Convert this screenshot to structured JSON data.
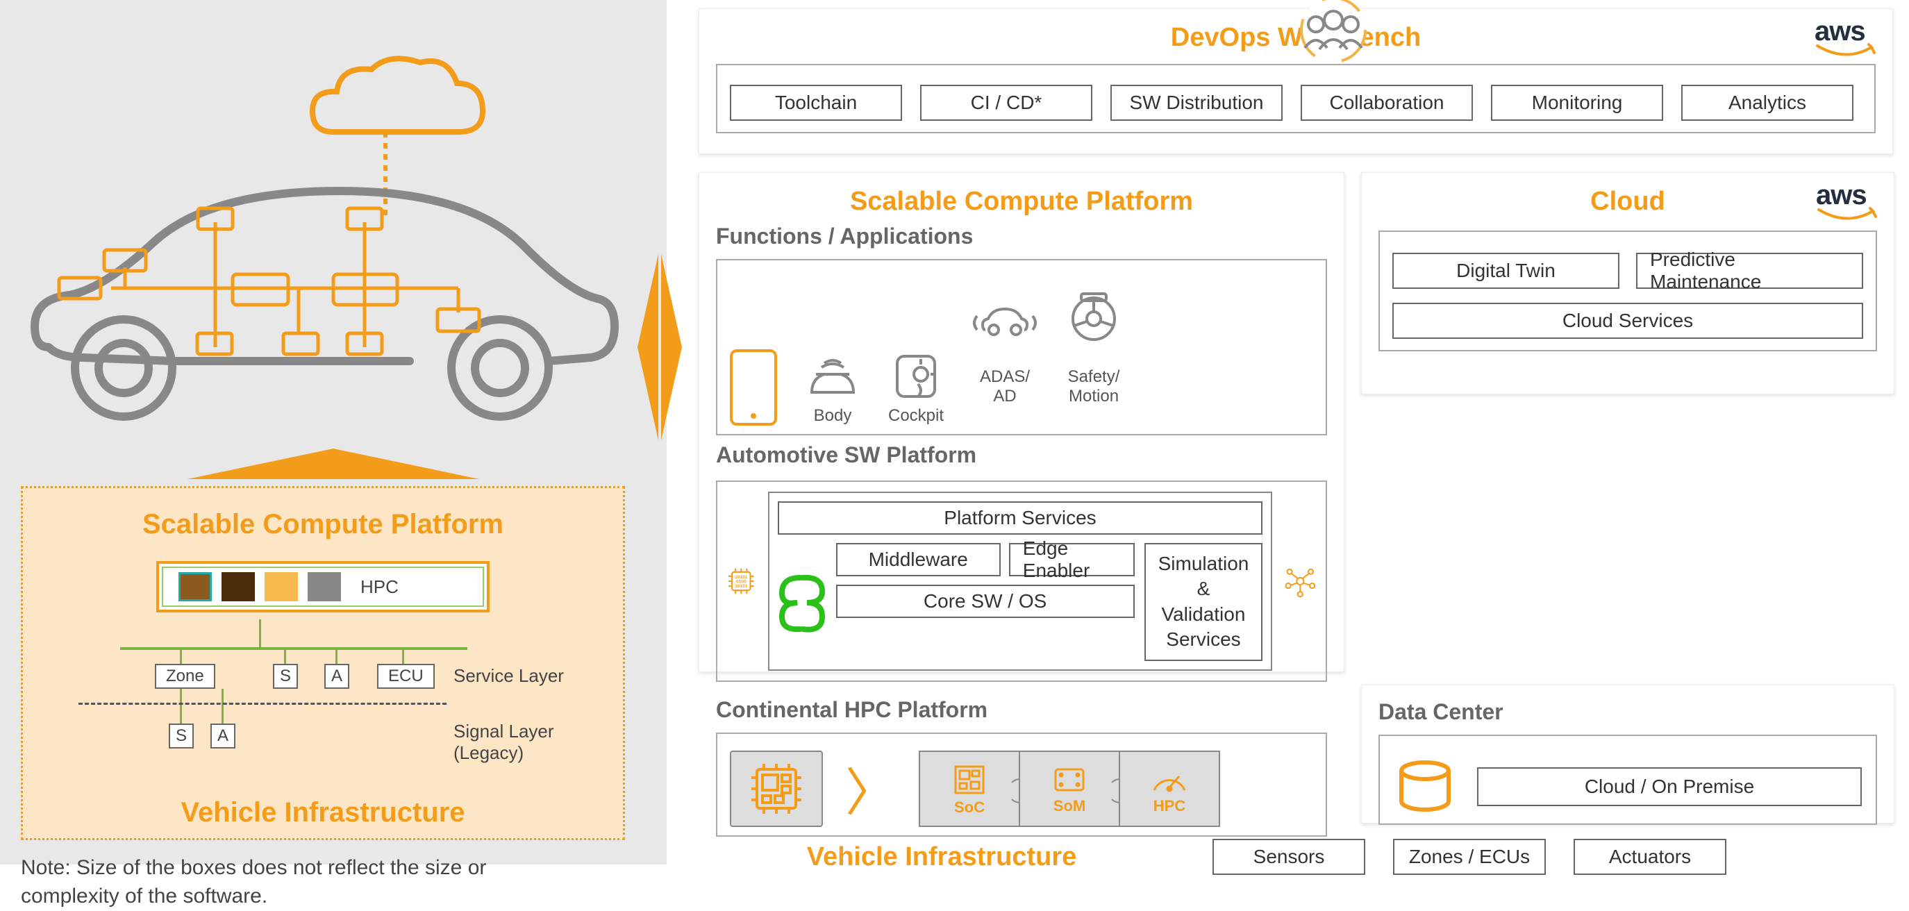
{
  "left": {
    "scp_title": "Scalable Compute Platform",
    "hpc_label": "HPC",
    "zone": "Zone",
    "s": "S",
    "a": "A",
    "ecu": "ECU",
    "service_layer": "Service Layer",
    "signal_layer": "Signal Layer\n(Legacy)",
    "vi_title": "Vehicle Infrastructure",
    "note": "Note: Size of the boxes does not reflect the size or\ncomplexity of the software."
  },
  "devops": {
    "title": "DevOps Workbench",
    "items": [
      "Toolchain",
      "CI / CD*",
      "SW Distribution",
      "Collaboration",
      "Monitoring",
      "Analytics"
    ],
    "aws": "aws"
  },
  "scp": {
    "title": "Scalable Compute Platform",
    "funcs_header": "Functions / Applications",
    "funcs": [
      "",
      "Body",
      "Cockpit",
      "ADAS/\nAD",
      "Safety/\nMotion"
    ],
    "sw_header": "Automotive SW Platform",
    "platform_services": "Platform Services",
    "middleware": "Middleware",
    "edge_enabler": "Edge Enabler",
    "core_sw": "Core SW / OS",
    "simval": "Simulation & Validation\nServices"
  },
  "hpc": {
    "title": "Continental HPC Platform",
    "labels": [
      "SoC",
      "SoM",
      "HPC"
    ]
  },
  "cloud": {
    "title": "Cloud",
    "digital_twin": "Digital Twin",
    "predictive": "Predictive Maintenance",
    "services": "Cloud Services",
    "aws": "aws"
  },
  "dc": {
    "title": "Data Center",
    "label": "Cloud / On Premise"
  },
  "vi": {
    "title": "Vehicle Infrastructure",
    "sensors": "Sensors",
    "zones": "Zones / ECUs",
    "actuators": "Actuators"
  }
}
